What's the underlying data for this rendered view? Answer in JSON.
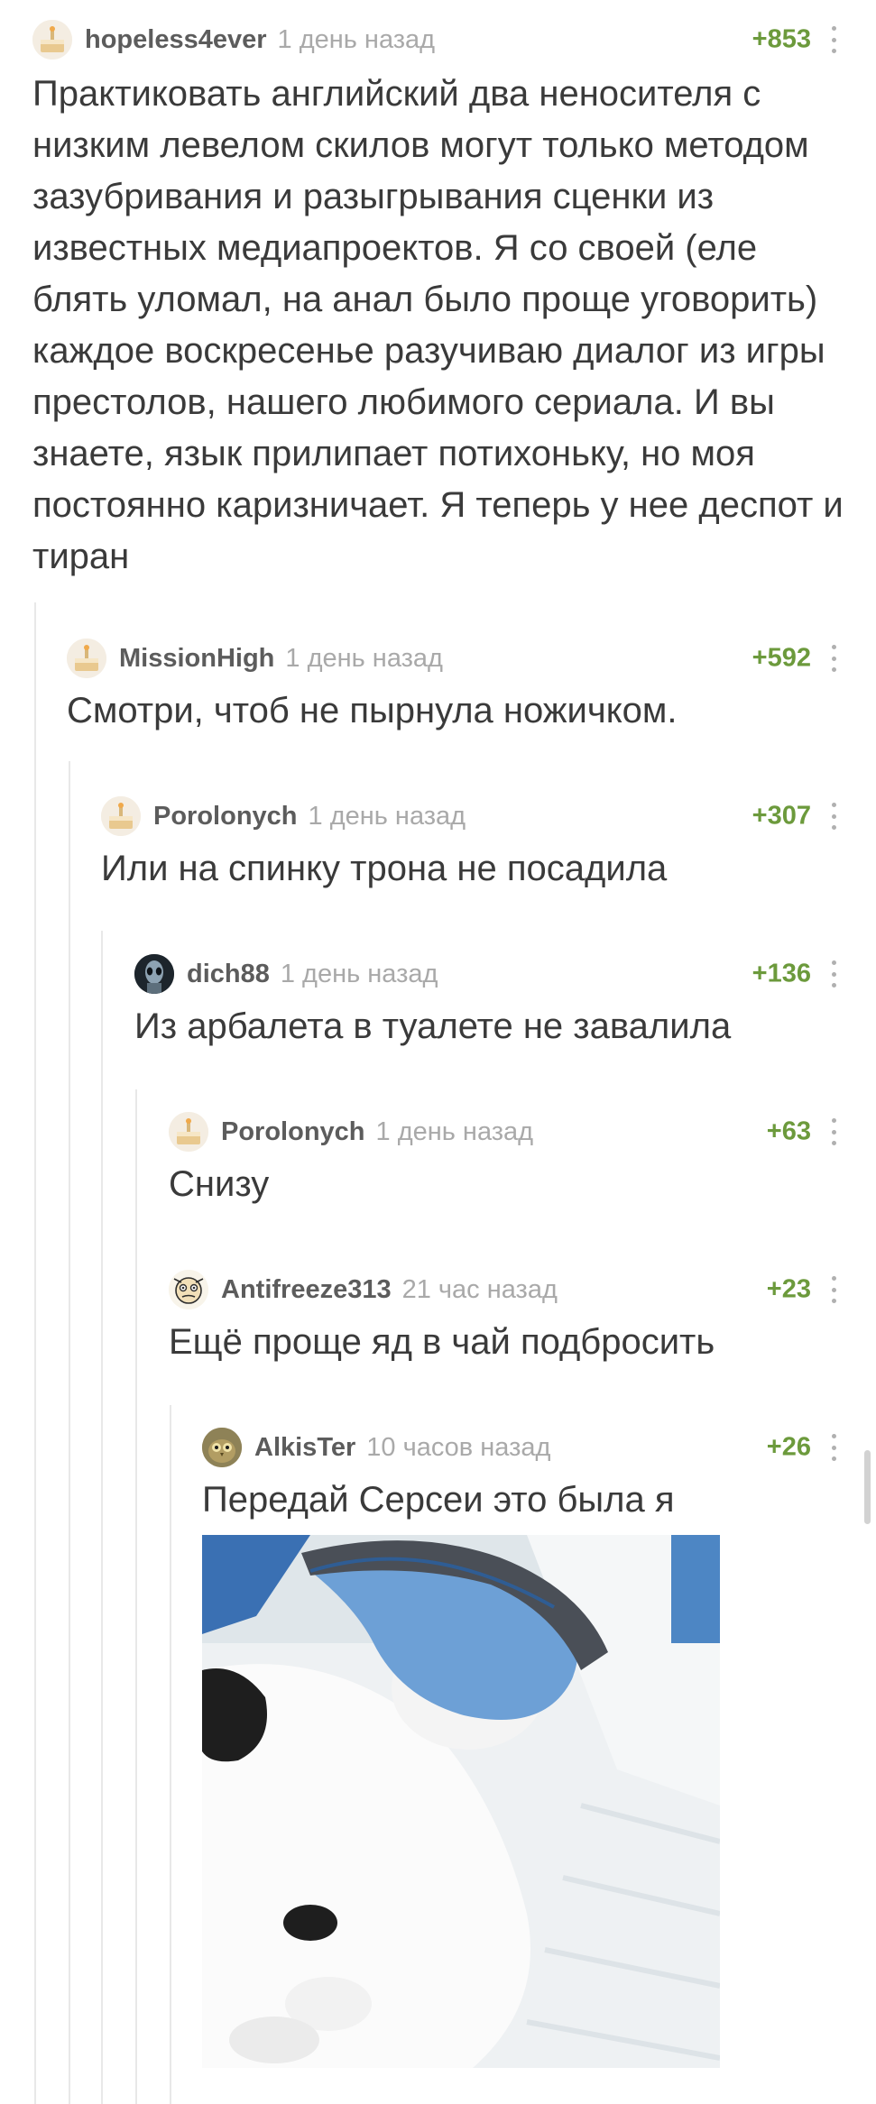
{
  "comments": [
    {
      "username": "hopeless4ever",
      "time": "1 день назад",
      "rating": "+853",
      "avatar": "cake-avatar",
      "text": "Практиковать английский два неносителя с низким левелом скилов могут только методом зазубривания и разыгрывания сценки из известных медиапроектов. Я со своей (еле блять уломал, на анал было проще уговорить) каждое воскресенье разучиваю диалог из игры престолов, нашего любимого сериала. И вы знаете, язык прилипает потихоньку, но моя постоянно каризничает. Я теперь у нее деспот и тиран"
    },
    {
      "username": "MissionHigh",
      "time": "1 день назад",
      "rating": "+592",
      "avatar": "cake-avatar",
      "text": "Смотри, чтоб не пырнула ножичком."
    },
    {
      "username": "Porolonych",
      "time": "1 день назад",
      "rating": "+307",
      "avatar": "cake-avatar",
      "text": "Или на спинку трона не посадила"
    },
    {
      "username": "dich88",
      "time": "1 день назад",
      "rating": "+136",
      "avatar": "alien-avatar",
      "text": "Из арбалета в туалете не завалила"
    },
    {
      "username": "Porolonych",
      "time": "1 день назад",
      "rating": "+63",
      "avatar": "cake-avatar",
      "text": "Снизу"
    },
    {
      "username": "Antifreeze313",
      "time": "21 час назад",
      "rating": "+23",
      "avatar": "face-avatar",
      "text": "Ещё проще яд в чай подбросить"
    },
    {
      "username": "AlkisTer",
      "time": "10 часов назад",
      "rating": "+26",
      "avatar": "owl-avatar",
      "text": "Передай Серсеи это была я"
    }
  ],
  "colors": {
    "rating": "#6c9a3c",
    "username": "#5c5c5c",
    "time": "#a9a9a9",
    "text": "#3a3a3a",
    "branch": "#e8e8e8"
  }
}
